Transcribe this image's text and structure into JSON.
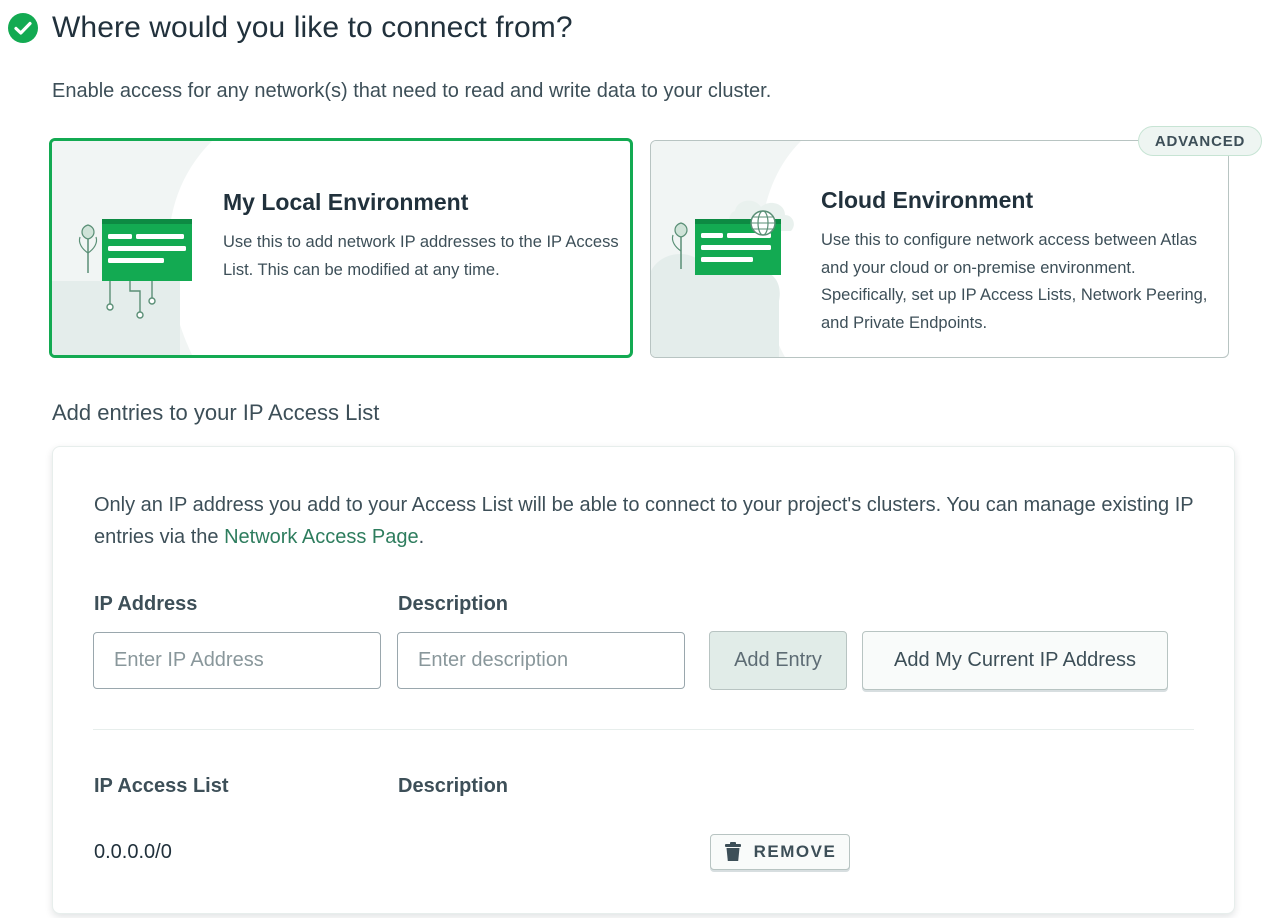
{
  "header": {
    "title": "Where would you like to connect from?",
    "subtitle": "Enable access for any network(s) that need to read and write data to your cluster."
  },
  "cards": {
    "local": {
      "title": "My Local Environment",
      "description": "Use this to add network IP addresses to the IP Access List. This can be modified at any time.",
      "selected": true
    },
    "cloud": {
      "badge": "ADVANCED",
      "title": "Cloud Environment",
      "description": "Use this to configure network access between Atlas and your cloud or on-premise environment. Specifically, set up IP Access Lists, Network Peering, and Private Endpoints."
    }
  },
  "access_list": {
    "section_title": "Add entries to your IP Access List",
    "notice_text": "Only an IP address you add to your Access List will be able to connect to your project's clusters. You can manage existing IP entries via the ",
    "notice_link": "Network Access Page",
    "notice_end": ".",
    "form": {
      "ip_label": "IP Address",
      "ip_placeholder": "Enter IP Address",
      "ip_value": "",
      "desc_label": "Description",
      "desc_placeholder": "Enter description",
      "desc_value": "",
      "add_button": "Add Entry",
      "current_ip_button": "Add My Current IP Address"
    },
    "table": {
      "col_ip": "IP Access List",
      "col_desc": "Description",
      "rows": [
        {
          "ip": "0.0.0.0/0",
          "description": "",
          "action": "REMOVE"
        }
      ]
    }
  },
  "colors": {
    "brand_green": "#13aa52",
    "link_green": "#2e7d5e",
    "text": "#3d4f58"
  }
}
